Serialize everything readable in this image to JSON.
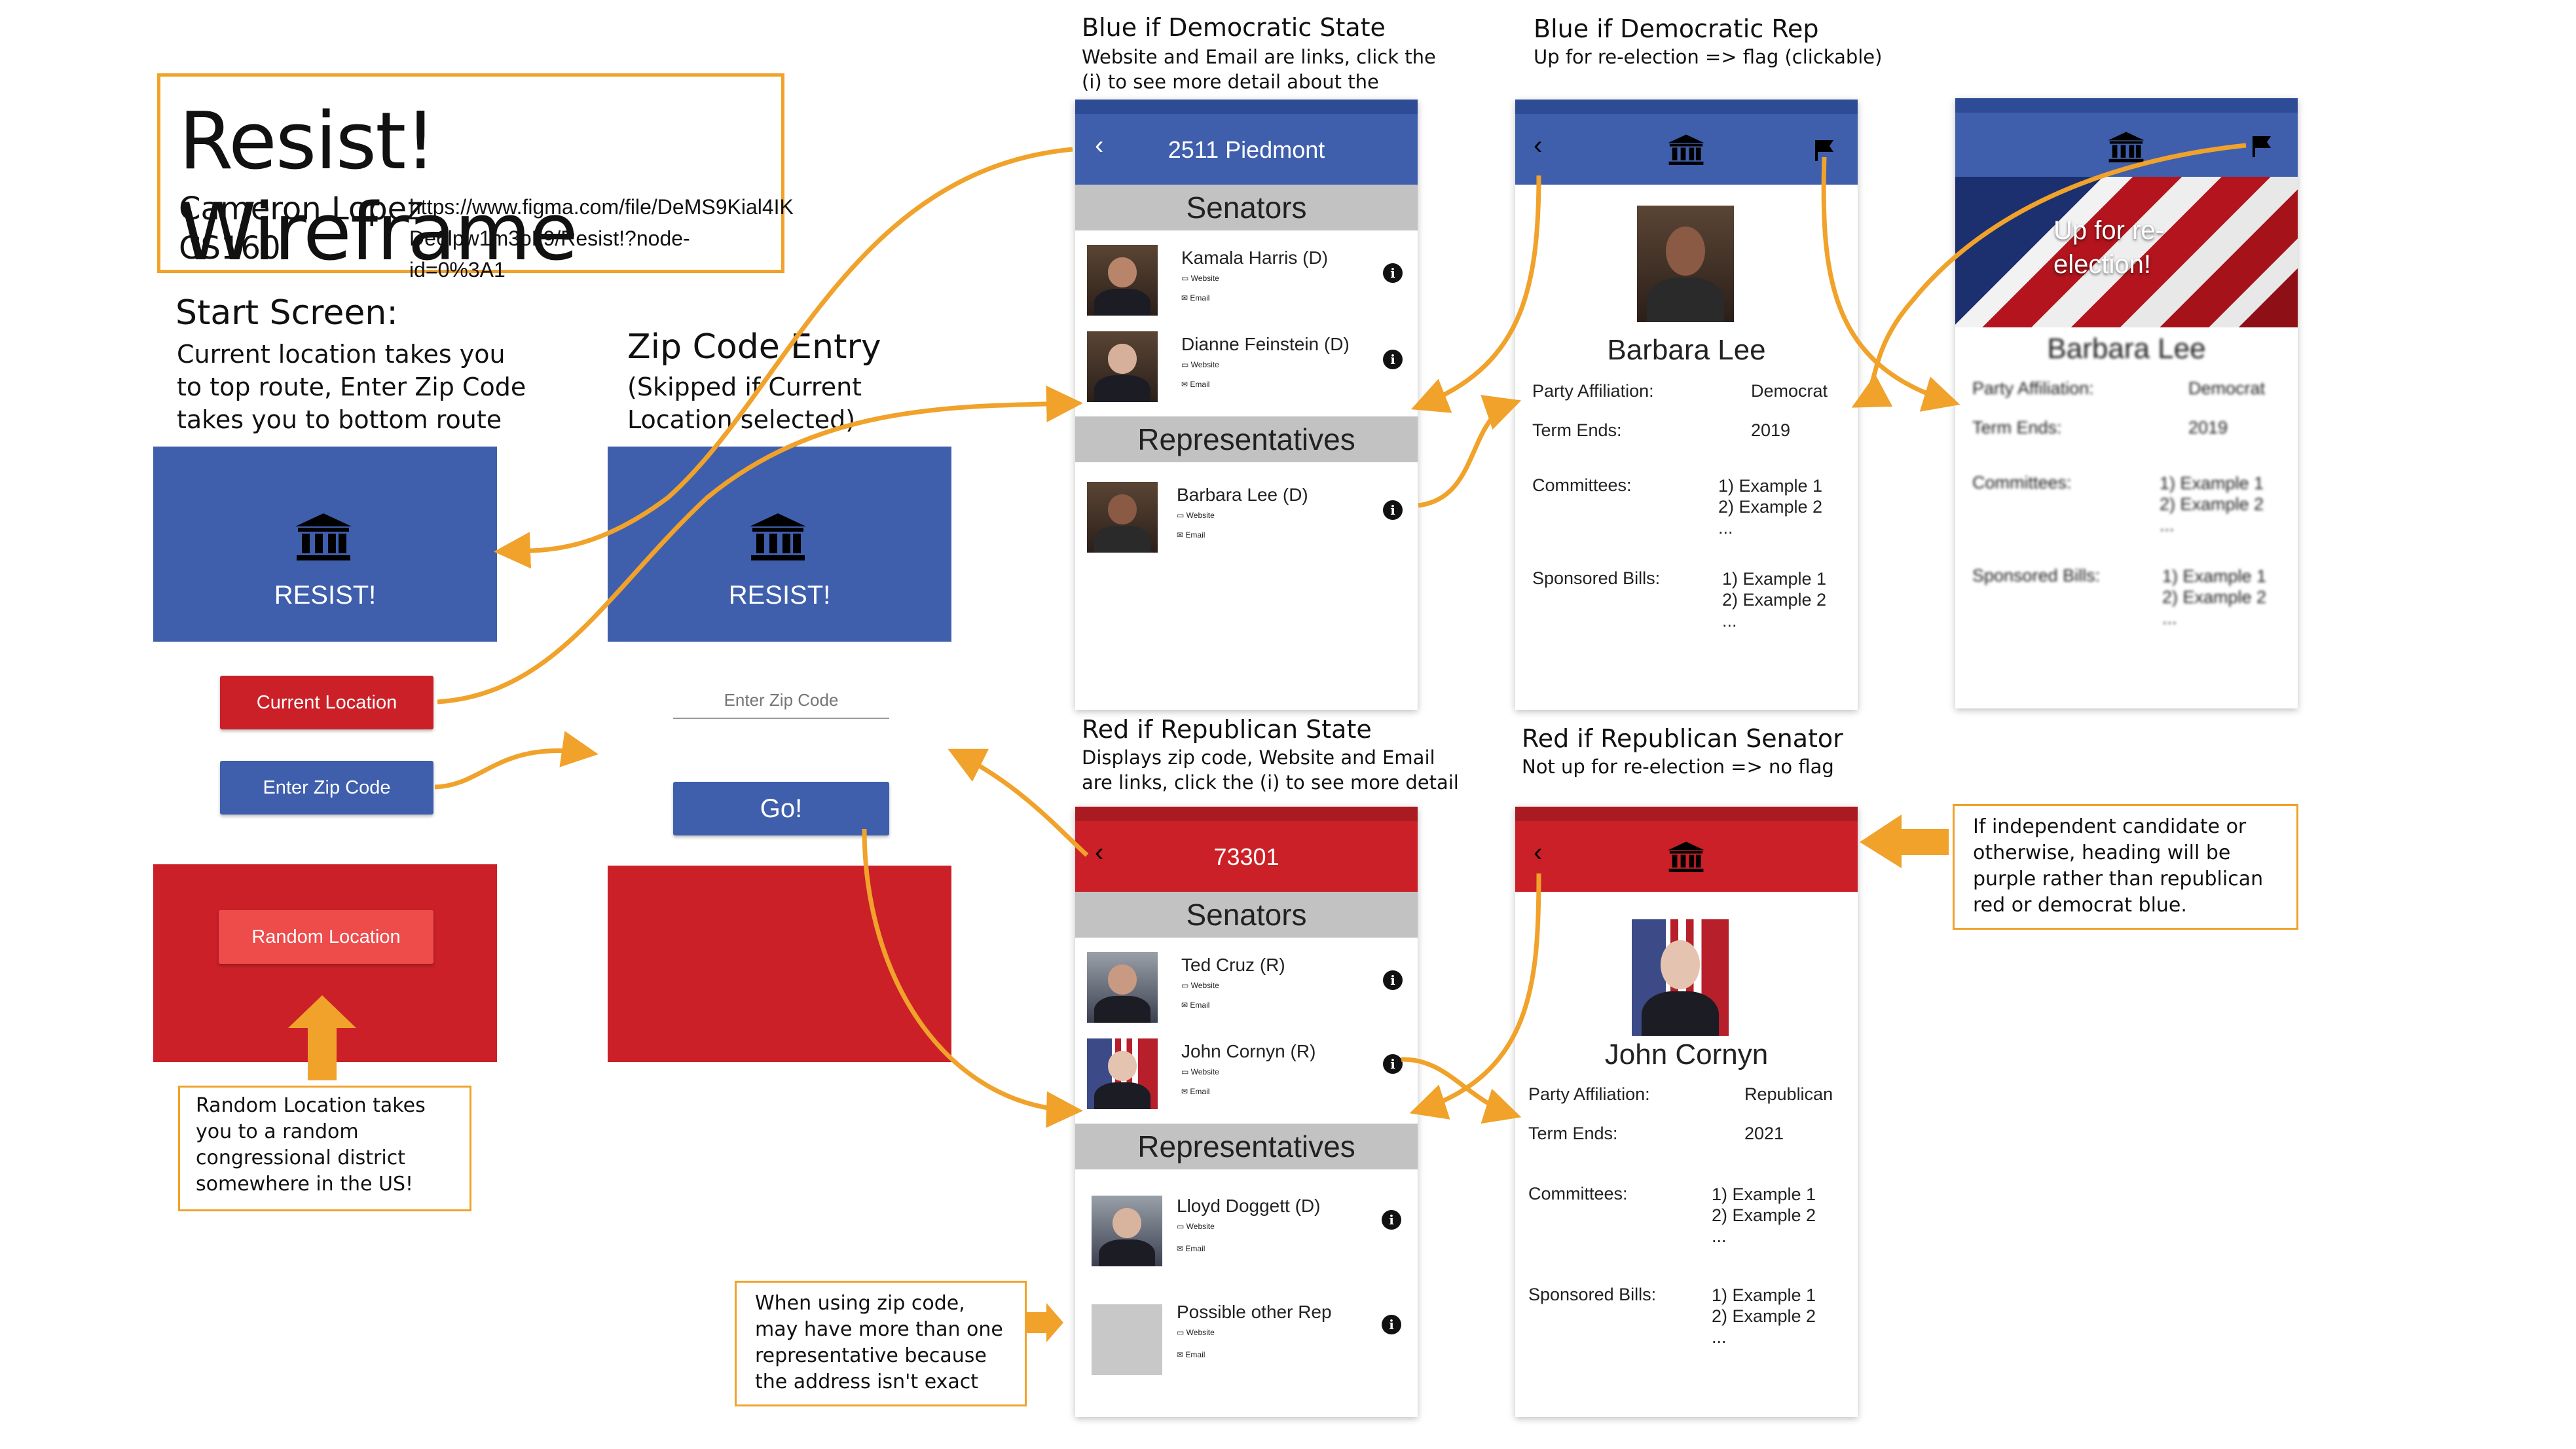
{
  "title": "Resist! Wireframe",
  "author": "Cameron Lopez",
  "course": "CS160",
  "figma_url": "https://www.figma.com/file/DeMS9Kial4IK De6lpw1m3oL9/Resist!?node-id=0%3A1",
  "start_screen": {
    "heading": "Start Screen:",
    "description": "Current location takes you to top route, Enter Zip Code takes you to bottom route",
    "app_name": "RESIST!",
    "current_location": "Current Location",
    "enter_zip": "Enter Zip Code",
    "random_location": "Random Location",
    "random_note": "Random Location takes you to a random congressional district somewhere in the US!"
  },
  "zip_screen": {
    "heading": "Zip Code Entry",
    "description": "(Skipped if Current Location selected)",
    "app_name": "RESIST!",
    "placeholder": "Enter Zip Code",
    "go": "Go!"
  },
  "dem_state": {
    "caption_title": "Blue if Democratic State",
    "caption_text": "Website and Email are links, click the (i) to see more detail about the person",
    "header": "2511 Piedmont",
    "senators_label": "Senators",
    "reps_label": "Representatives",
    "senators": [
      {
        "name": "Kamala Harris (D)",
        "website": "Website",
        "email": "Email"
      },
      {
        "name": "Dianne Feinstein (D)",
        "website": "Website",
        "email": "Email"
      }
    ],
    "reps": [
      {
        "name": "Barbara Lee (D)",
        "website": "Website",
        "email": "Email"
      }
    ]
  },
  "rep_state": {
    "caption_title": "Red if Republican State",
    "caption_text": "Displays zip code, Website and Email are links, click the (i) to see more detail",
    "header": "73301",
    "senators_label": "Senators",
    "reps_label": "Representatives",
    "senators": [
      {
        "name": "Ted Cruz (R)",
        "website": "Website",
        "email": "Email"
      },
      {
        "name": "John Cornyn (R)",
        "website": "Website",
        "email": "Email"
      }
    ],
    "reps": [
      {
        "name": "Lloyd Doggett (D)",
        "website": "Website",
        "email": "Email"
      },
      {
        "name": "Possible other Rep",
        "website": "Website",
        "email": "Email"
      }
    ]
  },
  "dem_rep": {
    "caption_title": "Blue if Democratic Rep",
    "caption_text": "Up for re-election => flag (clickable)",
    "name": "Barbara Lee",
    "party_label": "Party Affiliation:",
    "party": "Democrat",
    "term_label": "Term Ends:",
    "term": "2019",
    "committees_label": "Committees:",
    "committees": [
      "1) Example 1",
      "2) Example 2",
      "..."
    ],
    "bills_label": "Sponsored Bills:",
    "bills": [
      "1) Example 1",
      "2) Example 2",
      "..."
    ]
  },
  "reelection": {
    "banner": "Up for re-election!"
  },
  "rep_senator": {
    "caption_title": "Red if Republican Senator",
    "caption_text": "Not up for re-election => no flag",
    "name": "John Cornyn",
    "party_label": "Party Affiliation:",
    "party": "Republican",
    "term_label": "Term Ends:",
    "term": "2021",
    "committees_label": "Committees:",
    "committees": [
      "1) Example 1",
      "2) Example 2",
      "..."
    ],
    "bills_label": "Sponsored Bills:",
    "bills": [
      "1) Example 1",
      "2) Example 2",
      "..."
    ]
  },
  "independent_note": "If independent candidate or otherwise, heading will be purple rather than republican red or democrat blue.",
  "zip_note": "When using zip code, may have more than one representative because the address isn't exact",
  "colors": {
    "dem_blue": "#3f5fad",
    "gop_red": "#cb2027",
    "arrow_orange": "#f0a22a"
  }
}
